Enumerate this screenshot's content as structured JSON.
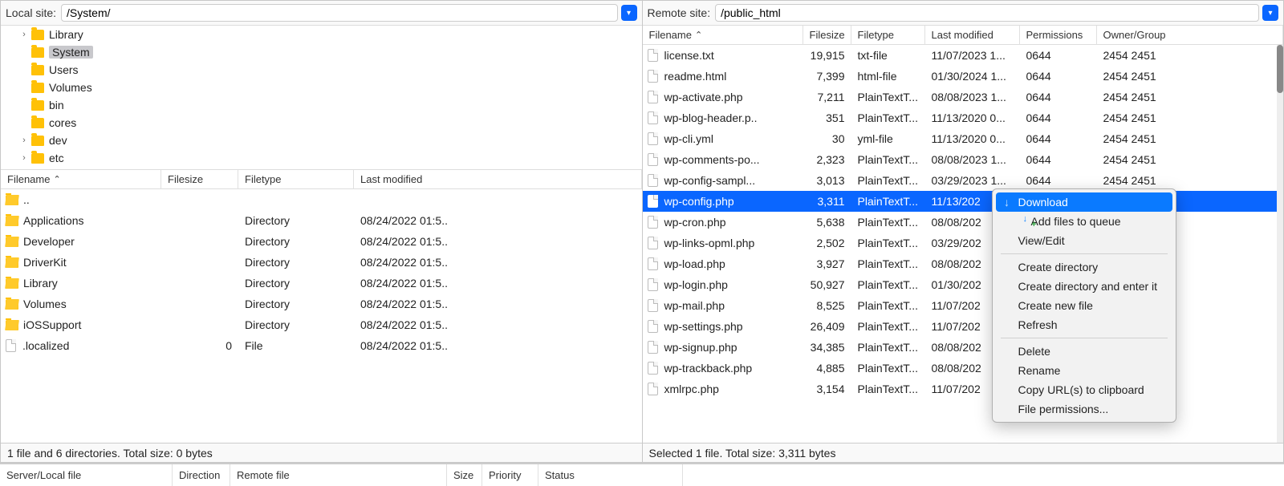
{
  "local": {
    "label": "Local site:",
    "path": "/System/",
    "tree": [
      {
        "chev": "›",
        "name": "Library",
        "selected": false
      },
      {
        "chev": "",
        "name": "System",
        "selected": true
      },
      {
        "chev": "",
        "name": "Users",
        "selected": false
      },
      {
        "chev": "",
        "name": "Volumes",
        "selected": false
      },
      {
        "chev": "",
        "name": "bin",
        "selected": false
      },
      {
        "chev": "",
        "name": "cores",
        "selected": false
      },
      {
        "chev": "›",
        "name": "dev",
        "selected": false
      },
      {
        "chev": "›",
        "name": "etc",
        "selected": false
      }
    ],
    "headers": {
      "filename": "Filename",
      "filesize": "Filesize",
      "filetype": "Filetype",
      "last_modified": "Last modified"
    },
    "files": [
      {
        "icon": "folder-up",
        "name": "..",
        "size": "",
        "type": "",
        "mod": ""
      },
      {
        "icon": "folder",
        "name": "Applications",
        "size": "",
        "type": "Directory",
        "mod": "08/24/2022 01:5.."
      },
      {
        "icon": "folder",
        "name": "Developer",
        "size": "",
        "type": "Directory",
        "mod": "08/24/2022 01:5.."
      },
      {
        "icon": "folder",
        "name": "DriverKit",
        "size": "",
        "type": "Directory",
        "mod": "08/24/2022 01:5.."
      },
      {
        "icon": "folder",
        "name": "Library",
        "size": "",
        "type": "Directory",
        "mod": "08/24/2022 01:5.."
      },
      {
        "icon": "folder",
        "name": "Volumes",
        "size": "",
        "type": "Directory",
        "mod": "08/24/2022 01:5.."
      },
      {
        "icon": "folder",
        "name": "iOSSupport",
        "size": "",
        "type": "Directory",
        "mod": "08/24/2022 01:5.."
      },
      {
        "icon": "file",
        "name": ".localized",
        "size": "0",
        "type": "File",
        "mod": "08/24/2022 01:5.."
      }
    ],
    "status": "1 file and 6 directories. Total size: 0 bytes"
  },
  "remote": {
    "label": "Remote site:",
    "path": "/public_html",
    "headers": {
      "filename": "Filename",
      "filesize": "Filesize",
      "filetype": "Filetype",
      "last_modified": "Last modified",
      "permissions": "Permissions",
      "owner": "Owner/Group"
    },
    "files": [
      {
        "name": "license.txt",
        "size": "19,915",
        "type": "txt-file",
        "mod": "11/07/2023 1...",
        "perm": "0644",
        "owner": "2454 2451",
        "sel": false
      },
      {
        "name": "readme.html",
        "size": "7,399",
        "type": "html-file",
        "mod": "01/30/2024 1...",
        "perm": "0644",
        "owner": "2454 2451",
        "sel": false
      },
      {
        "name": "wp-activate.php",
        "size": "7,211",
        "type": "PlainTextT...",
        "mod": "08/08/2023 1...",
        "perm": "0644",
        "owner": "2454 2451",
        "sel": false
      },
      {
        "name": "wp-blog-header.p..",
        "size": "351",
        "type": "PlainTextT...",
        "mod": "11/13/2020 0...",
        "perm": "0644",
        "owner": "2454 2451",
        "sel": false
      },
      {
        "name": "wp-cli.yml",
        "size": "30",
        "type": "yml-file",
        "mod": "11/13/2020 0...",
        "perm": "0644",
        "owner": "2454 2451",
        "sel": false
      },
      {
        "name": "wp-comments-po...",
        "size": "2,323",
        "type": "PlainTextT...",
        "mod": "08/08/2023 1...",
        "perm": "0644",
        "owner": "2454 2451",
        "sel": false
      },
      {
        "name": "wp-config-sampl...",
        "size": "3,013",
        "type": "PlainTextT...",
        "mod": "03/29/2023 1...",
        "perm": "0644",
        "owner": "2454 2451",
        "sel": false
      },
      {
        "name": "wp-config.php",
        "size": "3,311",
        "type": "PlainTextT...",
        "mod": "11/13/202",
        "perm": "",
        "owner": "",
        "sel": true
      },
      {
        "name": "wp-cron.php",
        "size": "5,638",
        "type": "PlainTextT...",
        "mod": "08/08/202",
        "perm": "",
        "owner": "",
        "sel": false
      },
      {
        "name": "wp-links-opml.php",
        "size": "2,502",
        "type": "PlainTextT...",
        "mod": "03/29/202",
        "perm": "",
        "owner": "",
        "sel": false
      },
      {
        "name": "wp-load.php",
        "size": "3,927",
        "type": "PlainTextT...",
        "mod": "08/08/202",
        "perm": "",
        "owner": "",
        "sel": false
      },
      {
        "name": "wp-login.php",
        "size": "50,927",
        "type": "PlainTextT...",
        "mod": "01/30/202",
        "perm": "",
        "owner": "",
        "sel": false
      },
      {
        "name": "wp-mail.php",
        "size": "8,525",
        "type": "PlainTextT...",
        "mod": "11/07/202",
        "perm": "",
        "owner": "",
        "sel": false
      },
      {
        "name": "wp-settings.php",
        "size": "26,409",
        "type": "PlainTextT...",
        "mod": "11/07/202",
        "perm": "",
        "owner": "",
        "sel": false
      },
      {
        "name": "wp-signup.php",
        "size": "34,385",
        "type": "PlainTextT...",
        "mod": "08/08/202",
        "perm": "",
        "owner": "",
        "sel": false
      },
      {
        "name": "wp-trackback.php",
        "size": "4,885",
        "type": "PlainTextT...",
        "mod": "08/08/202",
        "perm": "",
        "owner": "",
        "sel": false
      },
      {
        "name": "xmlrpc.php",
        "size": "3,154",
        "type": "PlainTextT...",
        "mod": "11/07/202",
        "perm": "",
        "owner": "",
        "sel": false
      }
    ],
    "status": "Selected 1 file. Total size: 3,311 bytes"
  },
  "context_menu": {
    "items": [
      {
        "label": "Download",
        "icon": "download",
        "highlight": true
      },
      {
        "label": "Add files to queue",
        "icon": "queue",
        "highlight": false
      },
      {
        "label": "View/Edit",
        "icon": "",
        "highlight": false
      },
      {
        "sep": true
      },
      {
        "label": "Create directory",
        "icon": "",
        "highlight": false
      },
      {
        "label": "Create directory and enter it",
        "icon": "",
        "highlight": false
      },
      {
        "label": "Create new file",
        "icon": "",
        "highlight": false
      },
      {
        "label": "Refresh",
        "icon": "",
        "highlight": false
      },
      {
        "sep": true
      },
      {
        "label": "Delete",
        "icon": "",
        "highlight": false
      },
      {
        "label": "Rename",
        "icon": "",
        "highlight": false
      },
      {
        "label": "Copy URL(s) to clipboard",
        "icon": "",
        "highlight": false
      },
      {
        "label": "File permissions...",
        "icon": "",
        "highlight": false
      }
    ]
  },
  "queue_headers": {
    "server": "Server/Local file",
    "direction": "Direction",
    "remote": "Remote file",
    "size": "Size",
    "priority": "Priority",
    "status": "Status"
  },
  "sort_arrow": "⌃"
}
